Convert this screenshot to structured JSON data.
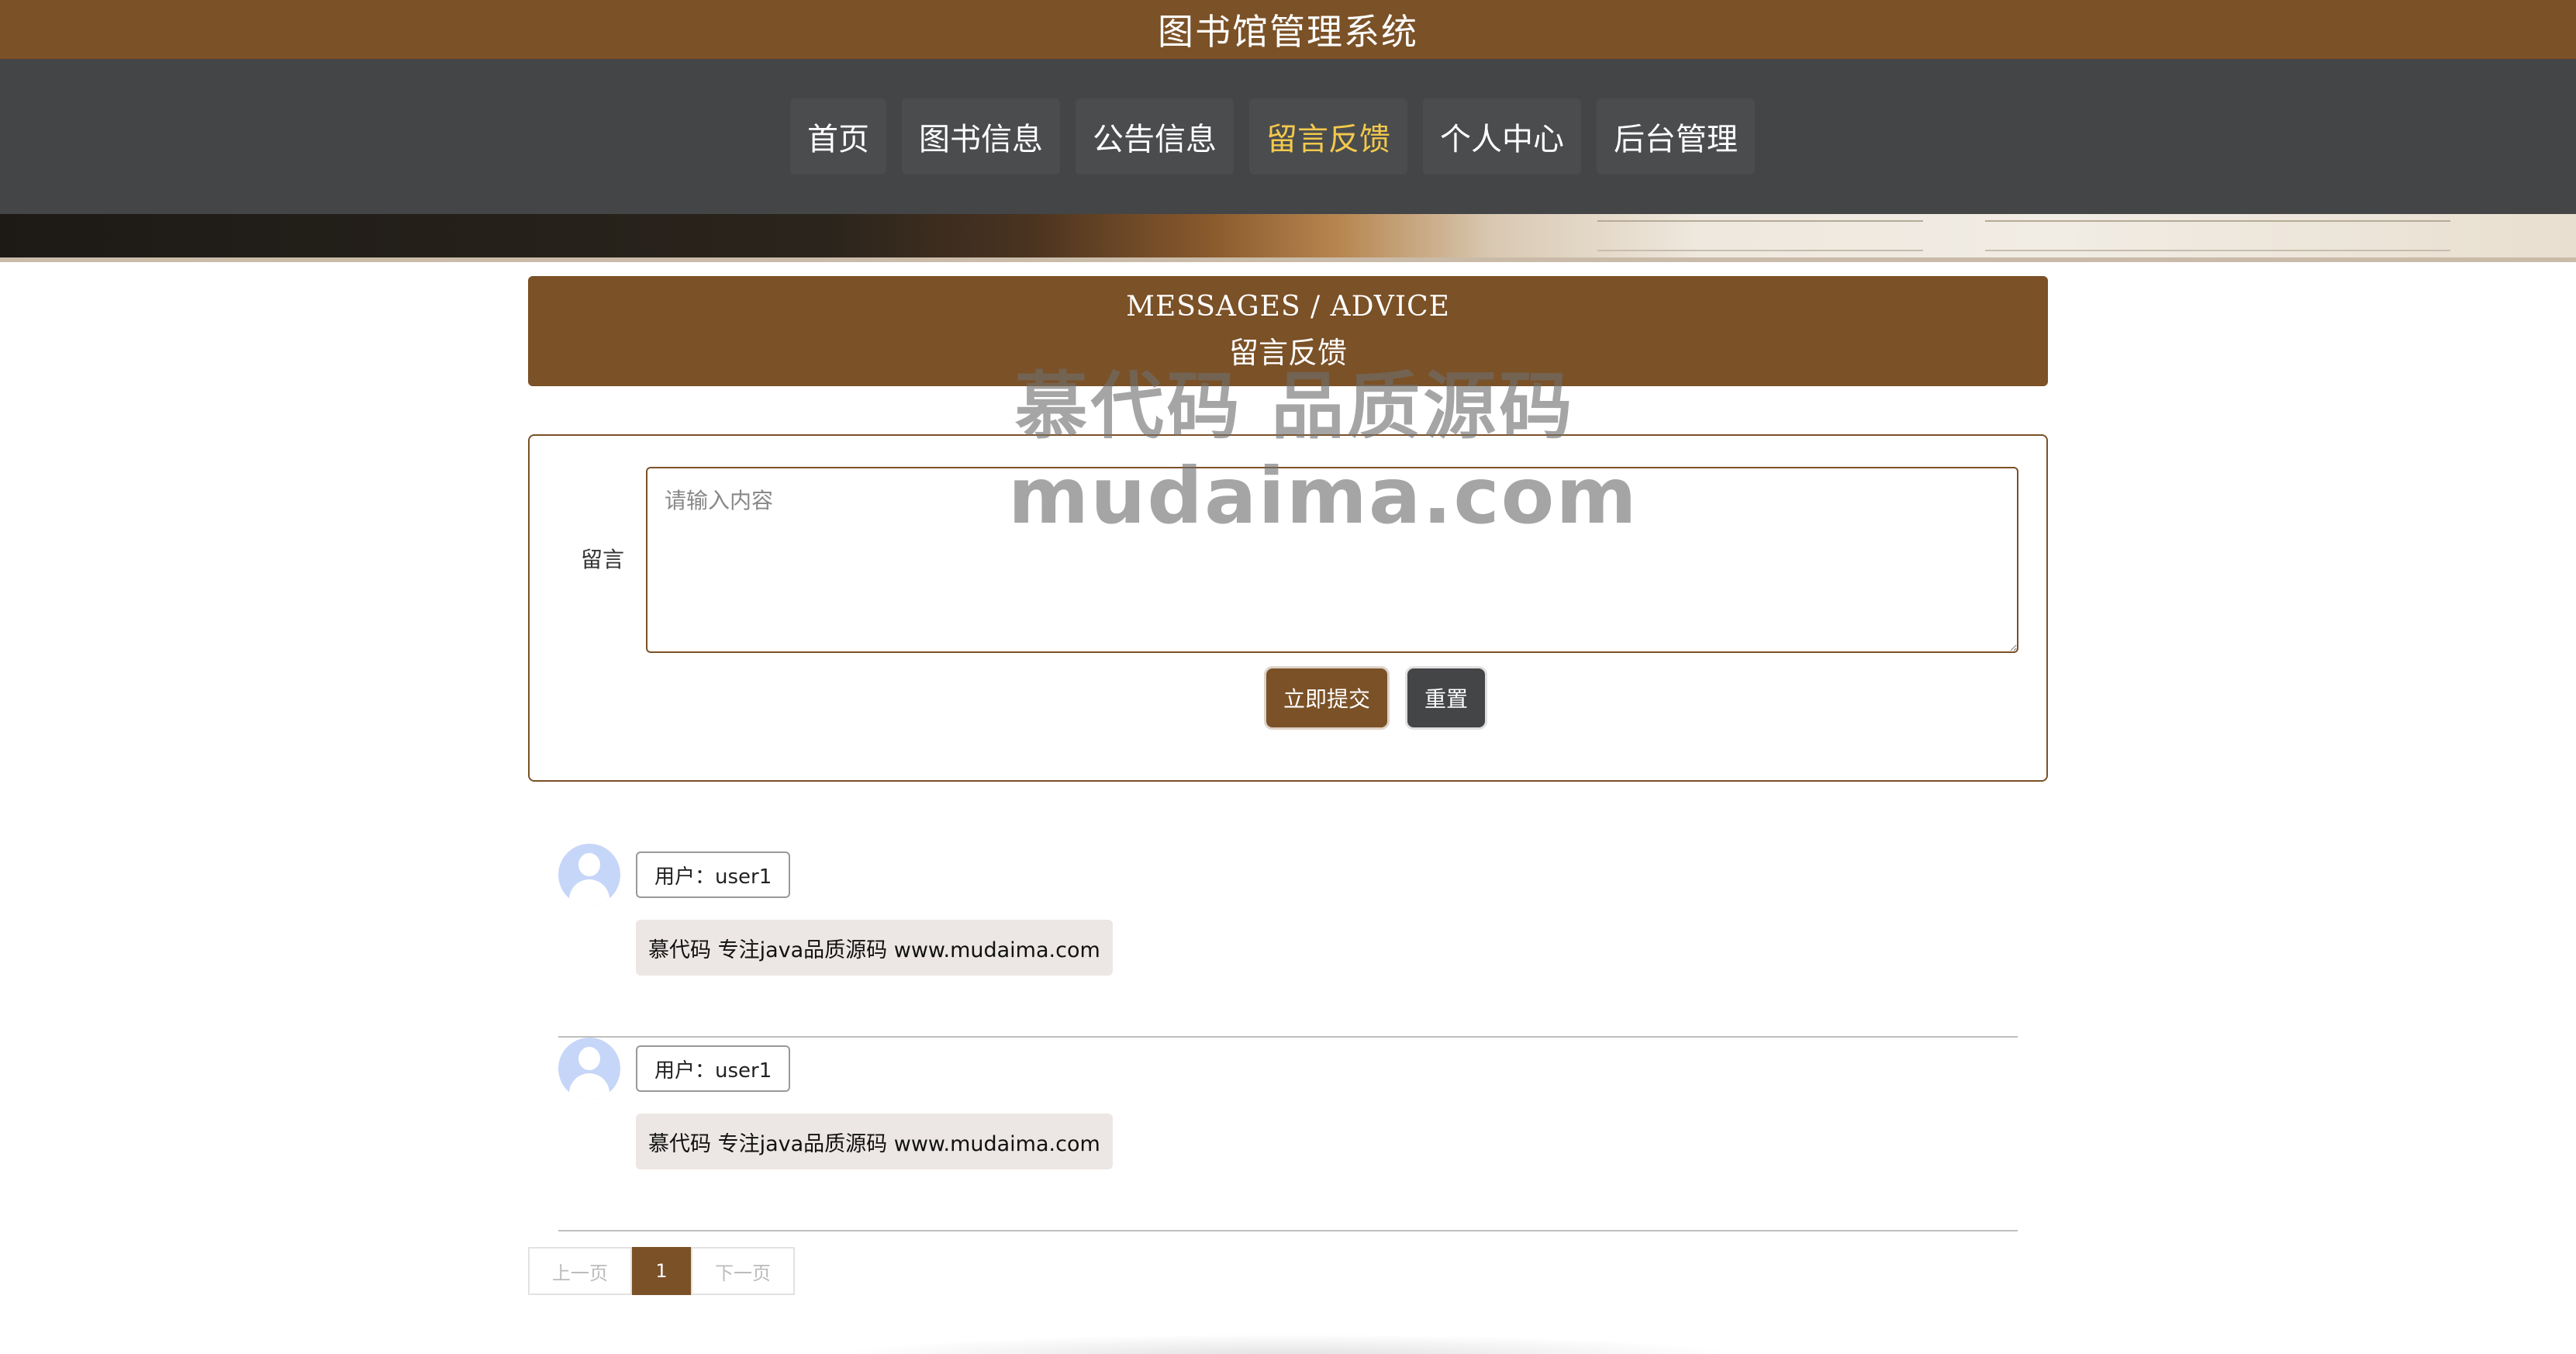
{
  "header": {
    "title": "图书馆管理系统"
  },
  "nav": {
    "items": [
      {
        "label": "首页",
        "active": false
      },
      {
        "label": "图书信息",
        "active": false
      },
      {
        "label": "公告信息",
        "active": false
      },
      {
        "label": "留言反馈",
        "active": true
      },
      {
        "label": "个人中心",
        "active": false
      },
      {
        "label": "后台管理",
        "active": false
      }
    ]
  },
  "section": {
    "title_en": "MESSAGES / ADVICE",
    "title_cn": "留言反馈"
  },
  "form": {
    "label": "留言",
    "placeholder": "请输入内容",
    "submit_label": "立即提交",
    "reset_label": "重置"
  },
  "messages": [
    {
      "user": "用户：user1",
      "content": "慕代码 专注java品质源码 www.mudaima.com"
    },
    {
      "user": "用户：user1",
      "content": "慕代码 专注java品质源码 www.mudaima.com"
    }
  ],
  "pagination": {
    "prev_label": "上一页",
    "current": "1",
    "next_label": "下一页"
  },
  "watermark": {
    "line1": "慕代码 品质源码",
    "line2": "mudaima.com"
  },
  "colors": {
    "brand": "#7b5127",
    "nav_bg": "#444547",
    "active_nav": "#f2c94c",
    "message_bg": "#ece6e4"
  }
}
